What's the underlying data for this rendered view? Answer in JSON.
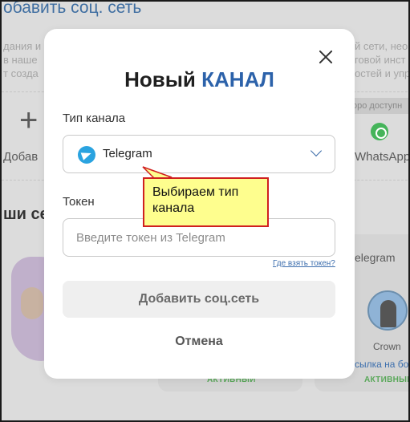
{
  "background": {
    "title": "обавить соц. сеть",
    "intro_left": [
      "дания и",
      "в наше",
      "т созда"
    ],
    "intro_right": [
      "й сети, нео",
      "говой инст",
      "остей и упр"
    ],
    "add_label": "Добав",
    "soon_badge": "оро доступн",
    "whatsapp_label": "WhatsApp",
    "section_heading": "ши се",
    "card_label_telegram": "elegram",
    "card_name": "Crown",
    "card_link": "сылка на бот",
    "status_active": "АКТИВНЫЙ"
  },
  "modal": {
    "title_prefix": "Новый",
    "title_accent": "КАНАЛ",
    "channel_type_label": "Тип канала",
    "channel_type_value": "Telegram",
    "token_label": "Токен",
    "token_placeholder": "Введите токен из Telegram",
    "token_value": "",
    "help_link": "Где взять токен?",
    "add_button": "Добавить соц.сеть",
    "cancel_button": "Отмена"
  },
  "annotation": {
    "text": "Выбираем тип канала"
  },
  "colors": {
    "accent": "#2c62aa",
    "callout_bg": "#fefe8e",
    "callout_border": "#d02020",
    "telegram": "#2aa3e0",
    "whatsapp": "#45b45a"
  },
  "icons": {
    "close": "close-icon",
    "channel": "telegram-icon",
    "dropdown": "chevron-down-icon",
    "whatsapp": "whatsapp-icon",
    "add": "plus-icon"
  }
}
